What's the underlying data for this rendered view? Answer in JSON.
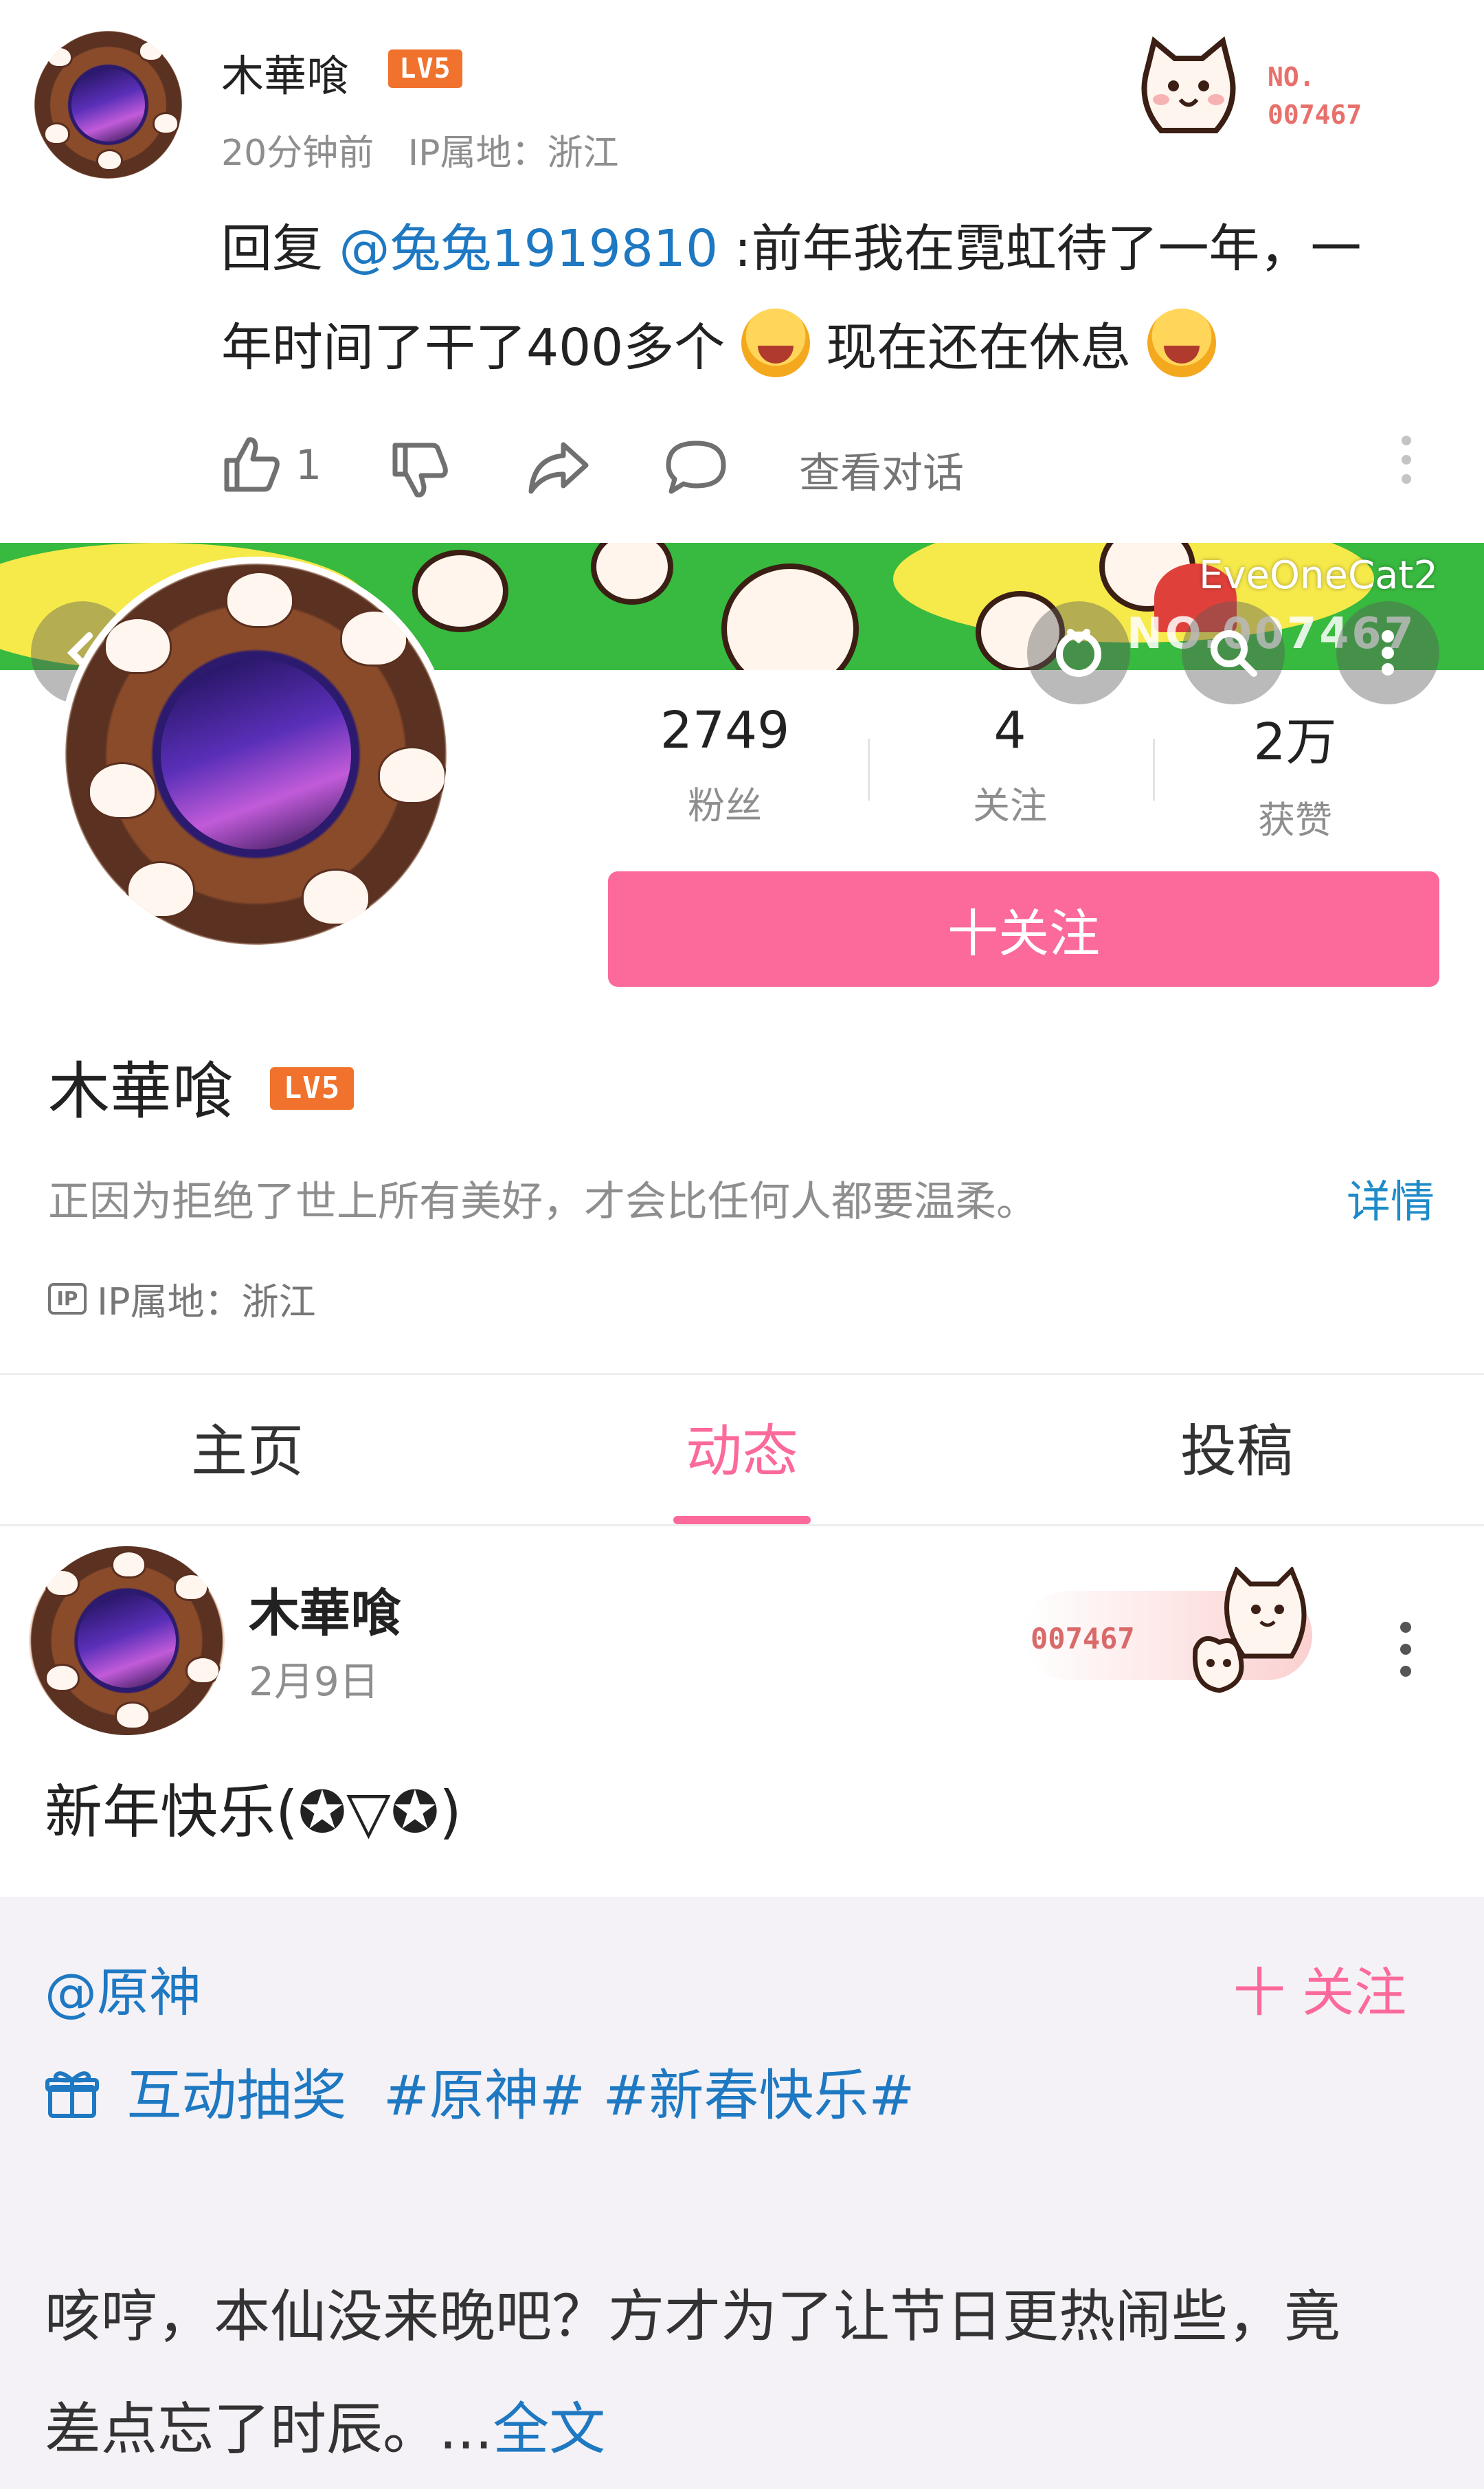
{
  "comment": {
    "username": "木華喰",
    "level_badge": "LV5",
    "meta": "20分钟前   IP属地：浙江",
    "fan_badge_label": "NO.",
    "fan_badge_number": "007467",
    "reply_prefix": "回复 ",
    "mention": "@兔兔1919810",
    "text_line1": " :前年我在霓虹待了一年，一",
    "text_line2_a": "年时间了干了400多个 ",
    "text_line2_b": " 现在还在休息 ",
    "like_count": "1",
    "view_conversation": "查看对话"
  },
  "profile": {
    "banner_watermark": "EveOneCat2",
    "banner_number": "NO.007467",
    "stats": [
      {
        "value": "2749",
        "label": "粉丝"
      },
      {
        "value": "4",
        "label": "关注"
      },
      {
        "value": "2万",
        "label": "获赞"
      }
    ],
    "follow_button": "十关注",
    "name": "木華喰",
    "level_badge": "LV5",
    "bio": "正因为拒绝了世上所有美好，才会比任何人都要温柔。",
    "details_link": "详情",
    "ip_icon_text": "IP",
    "ip": "IP属地：浙江"
  },
  "tabs": [
    {
      "label": "主页",
      "active": false
    },
    {
      "label": "动态",
      "active": true
    },
    {
      "label": "投稿",
      "active": false
    }
  ],
  "post": {
    "username": "木華喰",
    "date": "2月9日",
    "fan_badge_number": "007467",
    "content": "新年快乐(✪▽✪)"
  },
  "repost": {
    "author": "@原神",
    "follow_label": "十 关注",
    "lottery_label": "互动抽奖",
    "tags": "#原神# #新春快乐#",
    "text_line1": "咳哼，本仙没来晚吧？方才为了让节日更热闹些，竟",
    "text_line2": "差点忘了时辰。...",
    "full_text_link": "全文"
  },
  "colors": {
    "accent_pink": "#fb6a9a",
    "link_blue": "#1e78c2",
    "level_orange": "#f0722c",
    "repost_bg": "#f4f2f6"
  }
}
